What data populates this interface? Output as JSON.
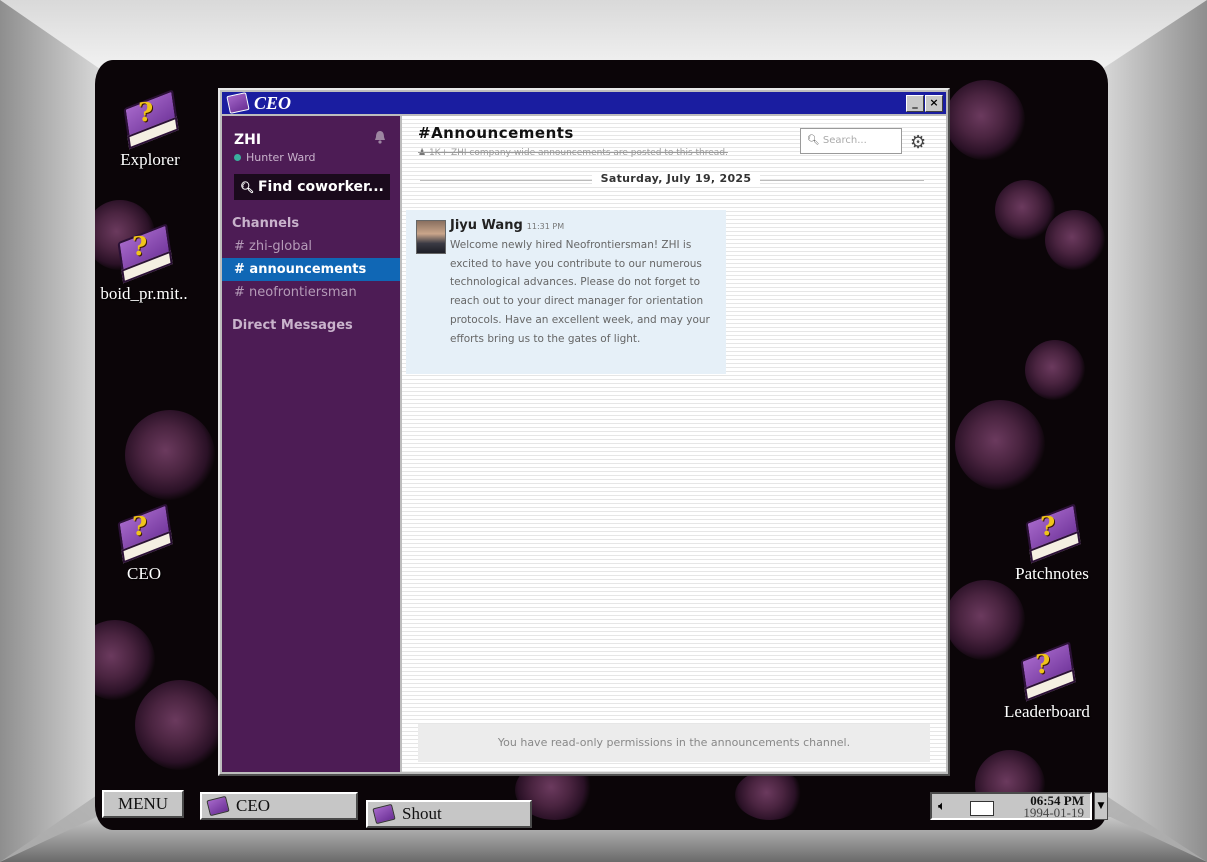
{
  "desktop": {
    "icons": [
      {
        "label": "Explorer"
      },
      {
        "label": "boid_pr.mit.."
      },
      {
        "label": "CEO"
      },
      {
        "label": "Patchnotes"
      },
      {
        "label": "Leaderboard"
      }
    ]
  },
  "window": {
    "title": "CEO",
    "minimize_label": "_",
    "close_label": "×"
  },
  "sidebar": {
    "workspace": "ZHI",
    "user": "Hunter Ward",
    "find_placeholder": "Find coworker...",
    "channels_heading": "Channels",
    "channels": [
      {
        "label": "# zhi-global",
        "active": false
      },
      {
        "label": "# announcements",
        "active": true
      },
      {
        "label": "# neofrontiersman",
        "active": false
      }
    ],
    "dm_heading": "Direct Messages"
  },
  "channel": {
    "title": "#Announcements",
    "description": "1K+ ZHI company-wide announcements are posted to this thread.",
    "search_placeholder": "Search...",
    "date": "Saturday, July 19, 2025",
    "messages": [
      {
        "author": "Jiyu Wang",
        "time": "11:31 PM",
        "text": "Welcome newly hired Neofrontiersman! ZHI is excited to have you contribute to our numerous technological advances. Please do not forget to reach out to your direct manager for orientation protocols. Have an excellent week, and may your efforts bring us to the gates of light."
      }
    ],
    "readonly_notice": "You have read-only permissions in the announcements channel."
  },
  "taskbar": {
    "menu_label": "MENU",
    "tasks": [
      {
        "label": "CEO"
      },
      {
        "label": "Shout"
      }
    ],
    "clock_time": "06:54 PM",
    "clock_date": "1994-01-19"
  },
  "colors": {
    "sidebar_bg": "#4d1c55",
    "active_channel": "#1067b5",
    "titlebar": "#1a1da0"
  }
}
